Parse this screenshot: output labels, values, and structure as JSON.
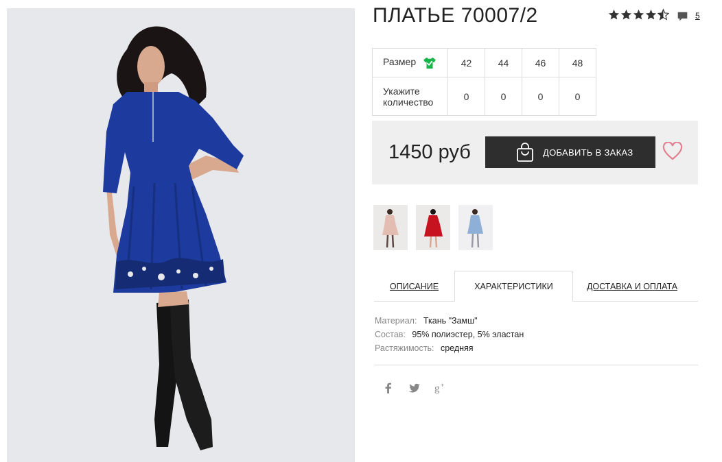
{
  "product": {
    "title": "ПЛАТЬЕ 70007/2",
    "rating": 4.5,
    "comments_count": "5"
  },
  "sizes": {
    "size_label": "Размер",
    "qty_label": "Укажите количество",
    "items": [
      {
        "size": "42",
        "qty": "0"
      },
      {
        "size": "44",
        "qty": "0"
      },
      {
        "size": "46",
        "qty": "0"
      },
      {
        "size": "48",
        "qty": "0"
      }
    ]
  },
  "purchase": {
    "price": "1450 руб",
    "add_label": "ДОБАВИТЬ В ЗАКАЗ"
  },
  "thumbnails": [
    {
      "dress_color": "#e3bcb2"
    },
    {
      "dress_color": "#c7121f"
    },
    {
      "dress_color": "#8fb0d6"
    }
  ],
  "tabs": {
    "description": "ОПИСАНИЕ",
    "characteristics": "ХАРАКТЕРИСТИКИ",
    "delivery": "ДОСТАВКА И ОПЛАТА"
  },
  "characteristics": [
    {
      "key": "Материал:",
      "value": "Ткань \"Замш\""
    },
    {
      "key": "Состав:",
      "value": "95% полиэстер, 5% эластан"
    },
    {
      "key": "Растяжимость:",
      "value": "средняя"
    }
  ],
  "colors": {
    "dress": "#1d3a9e",
    "button": "#2e2e2e",
    "heart": "#e37e8f",
    "check": "#18b44a",
    "stars": "#333333"
  },
  "icons": [
    "star-icon",
    "comment-icon",
    "shirt-check-icon",
    "shopping-bag-icon",
    "heart-icon",
    "facebook-icon",
    "twitter-icon",
    "google-plus-icon"
  ]
}
